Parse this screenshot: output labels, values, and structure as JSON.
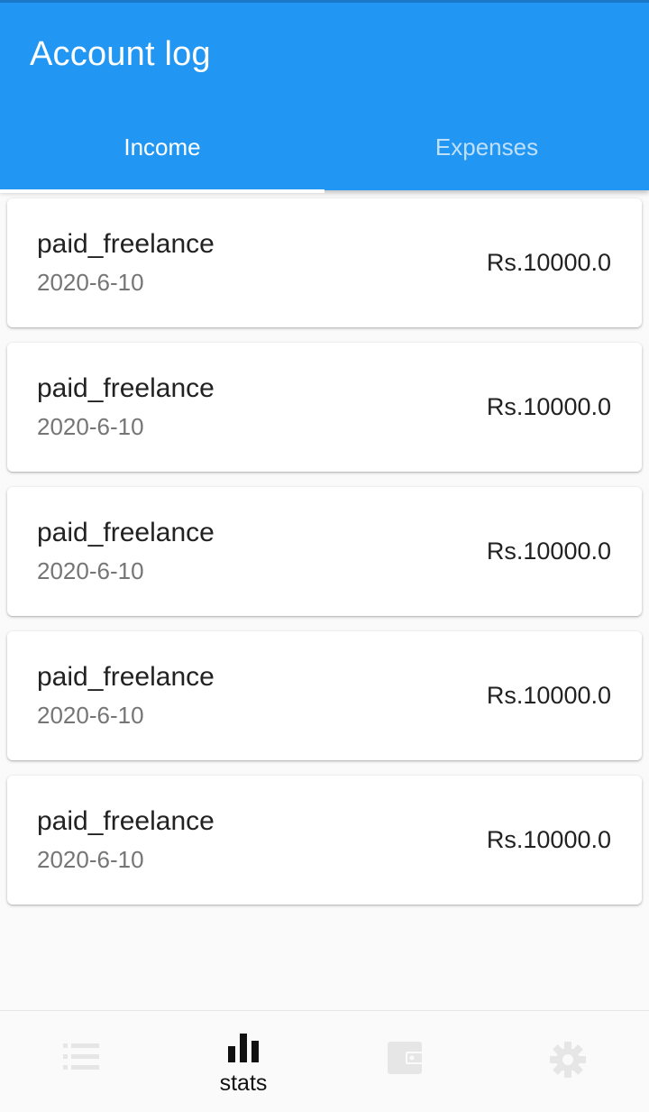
{
  "appbar": {
    "title": "Account log"
  },
  "tabs": [
    {
      "label": "Income",
      "active": true
    },
    {
      "label": "Expenses",
      "active": false
    }
  ],
  "entries": [
    {
      "title": "paid_freelance",
      "date": "2020-6-10",
      "amount": "Rs.10000.0"
    },
    {
      "title": "paid_freelance",
      "date": "2020-6-10",
      "amount": "Rs.10000.0"
    },
    {
      "title": "paid_freelance",
      "date": "2020-6-10",
      "amount": "Rs.10000.0"
    },
    {
      "title": "paid_freelance",
      "date": "2020-6-10",
      "amount": "Rs.10000.0"
    },
    {
      "title": "paid_freelance",
      "date": "2020-6-10",
      "amount": "Rs.10000.0"
    }
  ],
  "bottom_nav": {
    "items": [
      {
        "icon": "list-icon",
        "label": "",
        "active": false
      },
      {
        "icon": "bar-chart-icon",
        "label": "stats",
        "active": true
      },
      {
        "icon": "wallet-icon",
        "label": "",
        "active": false
      },
      {
        "icon": "gear-icon",
        "label": "",
        "active": false
      }
    ]
  },
  "colors": {
    "primary": "#2196f3",
    "tab_inactive": "#bfe0fb",
    "nav_active": "#111111",
    "nav_inactive": "#e6e6e6"
  }
}
